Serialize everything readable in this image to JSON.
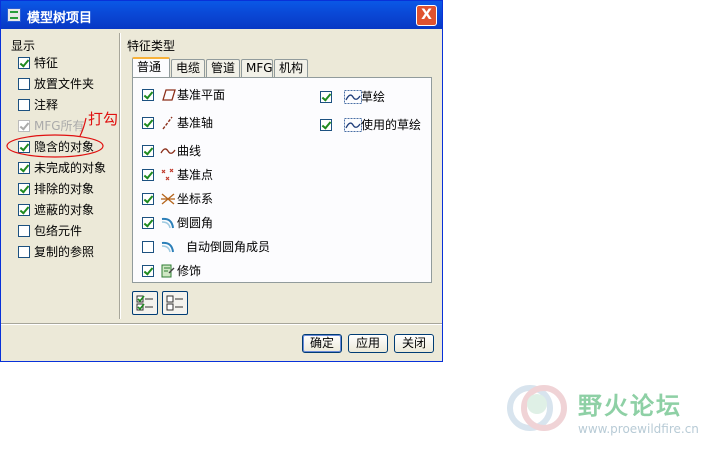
{
  "window": {
    "title": "模型树项目",
    "close_label": "X"
  },
  "display": {
    "title": "显示",
    "items": [
      {
        "label": "特征",
        "checked": true,
        "disabled": false
      },
      {
        "label": "放置文件夹",
        "checked": false,
        "disabled": false
      },
      {
        "label": "注释",
        "checked": false,
        "disabled": false
      },
      {
        "label": "MFG所有",
        "checked": true,
        "disabled": true
      },
      {
        "label": "隐含的对象",
        "checked": true,
        "disabled": false
      },
      {
        "label": "未完成的对象",
        "checked": true,
        "disabled": false
      },
      {
        "label": "排除的对象",
        "checked": true,
        "disabled": false
      },
      {
        "label": "遮蔽的对象",
        "checked": true,
        "disabled": false
      },
      {
        "label": "包络元件",
        "checked": false,
        "disabled": false
      },
      {
        "label": "复制的参照",
        "checked": false,
        "disabled": false
      }
    ]
  },
  "feature_types": {
    "title": "特征类型",
    "tabs": [
      {
        "label": "普通"
      },
      {
        "label": "电缆"
      },
      {
        "label": "管道"
      },
      {
        "label": "MFG"
      },
      {
        "label": "机构"
      }
    ],
    "active_tab": 0,
    "left_items": [
      {
        "label": "基准平面",
        "checked": true,
        "icon": "datum-plane-icon"
      },
      {
        "label": "基准轴",
        "checked": true,
        "icon": "datum-axis-icon"
      },
      {
        "label": "曲线",
        "checked": true,
        "icon": "curve-icon"
      },
      {
        "label": "基准点",
        "checked": true,
        "icon": "datum-point-icon"
      },
      {
        "label": "坐标系",
        "checked": true,
        "icon": "coordinate-system-icon"
      },
      {
        "label": "倒圆角",
        "checked": true,
        "icon": "round-icon"
      },
      {
        "label": "自动倒圆角成员",
        "checked": false,
        "icon": "auto-round-member-icon"
      },
      {
        "label": "修饰",
        "checked": true,
        "icon": "cosmetic-icon"
      }
    ],
    "right_items": [
      {
        "label": "草绘",
        "checked": true,
        "icon": "sketch-icon"
      },
      {
        "label": "使用的草绘",
        "checked": true,
        "icon": "used-sketch-icon"
      }
    ]
  },
  "buttons": {
    "ok": "确定",
    "apply": "应用",
    "close": "关闭"
  },
  "annotation": {
    "text": "打勾"
  },
  "watermark": {
    "title": "野火论坛",
    "url": "www.proewildfire.cn"
  }
}
